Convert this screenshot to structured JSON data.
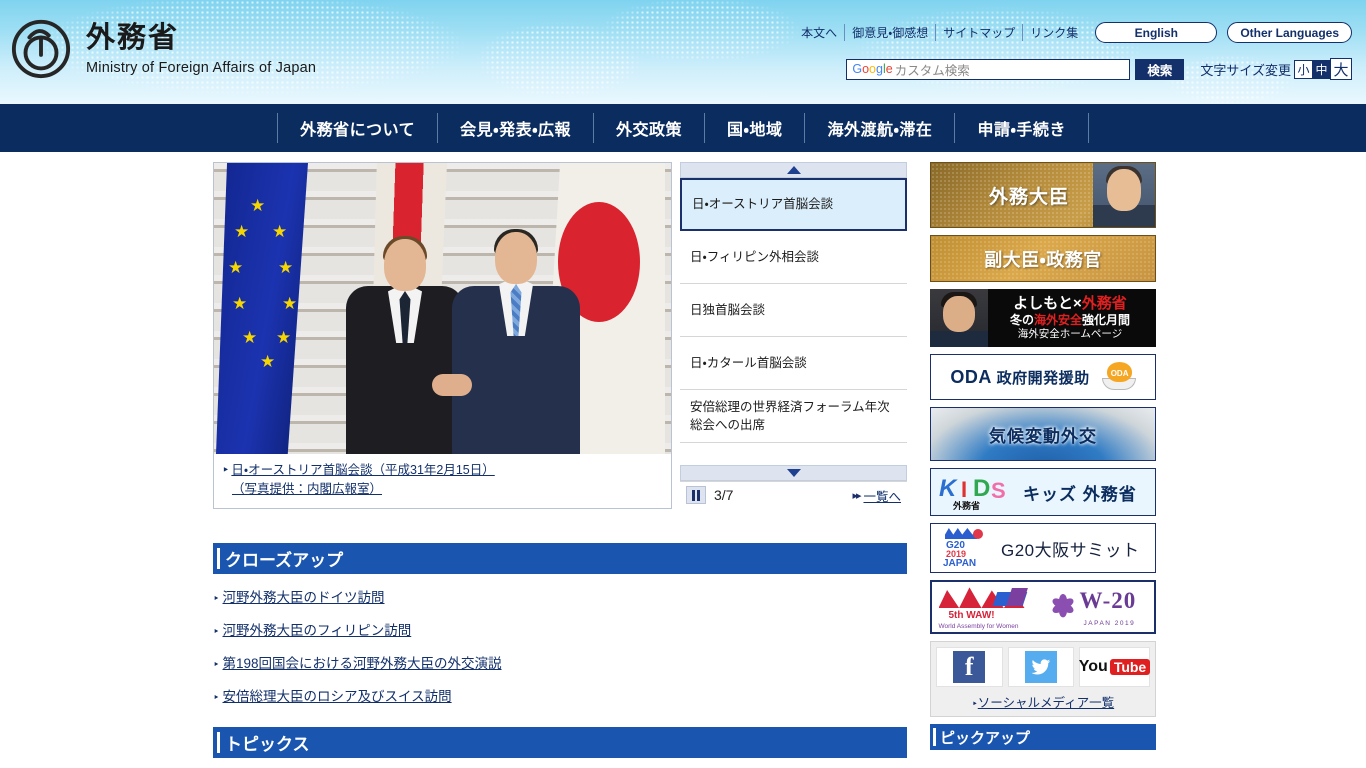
{
  "header": {
    "logo_icon": "mofa-circle-logo",
    "title_jp": "外務省",
    "title_en": "Ministry of Foreign Affairs of Japan",
    "util_links": [
      {
        "label": "本文へ"
      },
      {
        "label": "御意見・御感想"
      },
      {
        "label": "サイトマップ"
      },
      {
        "label": "リンク集"
      }
    ],
    "english_button": "English",
    "other_languages_button": "Other Languages",
    "search": {
      "brand_letters": [
        "G",
        "o",
        "o",
        "g",
        "l",
        "e"
      ],
      "placeholder": "カスタム検索",
      "submit_label": "検索"
    },
    "font_size": {
      "label": "文字サイズ変更",
      "options": [
        {
          "label": "小",
          "selected": false
        },
        {
          "label": "中",
          "selected": true
        },
        {
          "label": "大",
          "selected": false
        }
      ]
    }
  },
  "gnav": {
    "items": [
      {
        "label": "外務省について"
      },
      {
        "label": "会見・発表・広報"
      },
      {
        "label": "外交政策"
      },
      {
        "label": "国・地域"
      },
      {
        "label": "海外渡航・滞在"
      },
      {
        "label": "申請・手続き"
      }
    ]
  },
  "carousel": {
    "photo_alt": "日・オーストリア首脳会談の握手写真",
    "caption_line1": "日・オーストリア首脳会談（平成31年2月15日）",
    "caption_line2": "（写真提供：内閣広報室）",
    "up_arrow_icon": "triangle-up-icon",
    "down_arrow_icon": "triangle-down-icon",
    "items": [
      {
        "label": "日・オーストリア首脳会談",
        "selected": true
      },
      {
        "label": "日・フィリピン外相会談",
        "selected": false
      },
      {
        "label": "日独首脳会談",
        "selected": false
      },
      {
        "label": "日・カタール首脳会談",
        "selected": false
      },
      {
        "label": "安倍総理の世界経済フォーラム年次総会への出席",
        "selected": false
      }
    ],
    "pause_icon": "pause-icon",
    "counter": "3/7",
    "next_icon": "fast-forward-icon",
    "list_link": "一覧へ"
  },
  "closeup": {
    "heading": "クローズアップ",
    "links": [
      {
        "label": "河野外務大臣のドイツ訪問"
      },
      {
        "label": "河野外務大臣のフィリピン訪問"
      },
      {
        "label": "第198回国会における河野外務大臣の外交演説"
      },
      {
        "label": "安倍総理大臣のロシア及びスイス訪問"
      }
    ]
  },
  "topics": {
    "heading": "トピックス"
  },
  "sidebar": {
    "minister_banner": "外務大臣",
    "vice_minister_banner": "副大臣・政務官",
    "yoshimoto": {
      "line1_a": "よしもと×",
      "line1_b": "外務省",
      "line2_a": "冬の",
      "line2_b": "海外安全",
      "line2_c": "強化月間",
      "line3": "海外安全ホームページ"
    },
    "oda": {
      "acronym": "ODA",
      "label": "政府開発援助",
      "mascot_text": "ODA"
    },
    "climate_banner": "気候変動外交",
    "kids": {
      "logo_letters": [
        "K",
        "I",
        "D",
        "S"
      ],
      "logo_sub": "外務省",
      "label": "キッズ 外務省"
    },
    "g20": {
      "mark_line1": "G20",
      "mark_line2": "2019",
      "mark_line3": "JAPAN",
      "label": "G20大阪サミット"
    },
    "waw": {
      "left_title": "5th WAW!",
      "left_sub": "World Assembly for Women",
      "right_title": "W-20",
      "right_sub": "JAPAN 2019"
    },
    "social": {
      "facebook_icon": "facebook-icon",
      "facebook_glyph": "f",
      "twitter_icon": "twitter-icon",
      "twitter_glyph": "🐦",
      "youtube_icon": "youtube-icon",
      "youtube_you": "You",
      "youtube_tube": "Tube",
      "list_link": "ソーシャルメディア一覧"
    },
    "pickup_heading": "ピックアップ"
  },
  "colors": {
    "nav_navy": "#0b2c5e",
    "section_blue": "#1a56b0",
    "link_navy": "#13306b",
    "header_sky": "#9fdff4",
    "selected_item_bg": "#dbeefb"
  }
}
